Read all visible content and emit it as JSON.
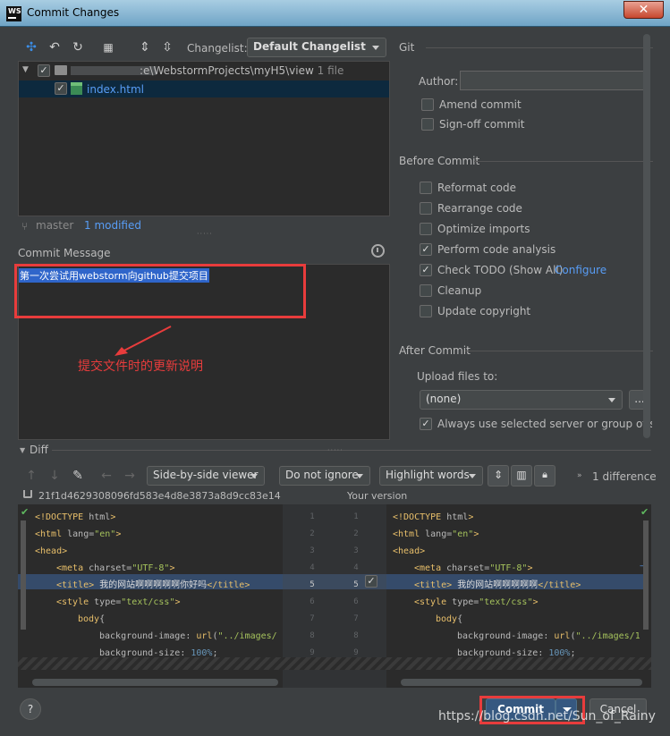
{
  "window": {
    "app_icon": "WS",
    "title": "Commit Changes",
    "close": "✕"
  },
  "toolbar": {
    "changelist_label": "Changelist:",
    "changelist_value": "Default Changelist"
  },
  "tree": {
    "root_path": ":e\\WebstormProjects\\myH5\\view",
    "root_count": "1 file",
    "file": "index.html"
  },
  "status": {
    "branch": "master",
    "modified": "1 modified"
  },
  "commit": {
    "label": "Commit Message",
    "text": "第一次尝试用webstorm向github提交项目",
    "annotation": "提交文件时的更新说明"
  },
  "git": {
    "title": "Git",
    "author_label": "Author:",
    "author_value": "",
    "amend": "Amend commit",
    "signoff": "Sign-off commit"
  },
  "before": {
    "title": "Before Commit",
    "items": [
      {
        "label": "Reformat code",
        "checked": false
      },
      {
        "label": "Rearrange code",
        "checked": false
      },
      {
        "label": "Optimize imports",
        "checked": false
      },
      {
        "label": "Perform code analysis",
        "checked": true
      },
      {
        "label": "Check TODO (Show All)",
        "checked": true
      },
      {
        "label": "Cleanup",
        "checked": false
      },
      {
        "label": "Update copyright",
        "checked": false
      }
    ],
    "configure": "Configure"
  },
  "after": {
    "title": "After Commit",
    "upload_label": "Upload files to:",
    "upload_value": "(none)",
    "more": "...",
    "always": "Always use selected server or group of servers"
  },
  "diff": {
    "title": "Diff",
    "viewer": "Side-by-side viewer",
    "ignore": "Do not ignore",
    "highlight": "Highlight words",
    "difference": "1 difference",
    "hash": "21f1d4629308096fd583e4d8e3873a8d9cc83e14",
    "your_version": "Your version",
    "line_numbers": [
      "1",
      "2",
      "3",
      "4",
      "5",
      "6",
      "7",
      "8",
      "9"
    ]
  },
  "buttons": {
    "help": "?",
    "commit": "Commit",
    "cancel": "Cancel"
  },
  "watermark": "https://blog.csdn.net/Sun_of_Rainy",
  "colors": {
    "bg": "#3c3f41",
    "editor": "#2b2b2b",
    "selection": "#2f65ca",
    "link": "#589df6",
    "highlight": "#e83c3c"
  }
}
